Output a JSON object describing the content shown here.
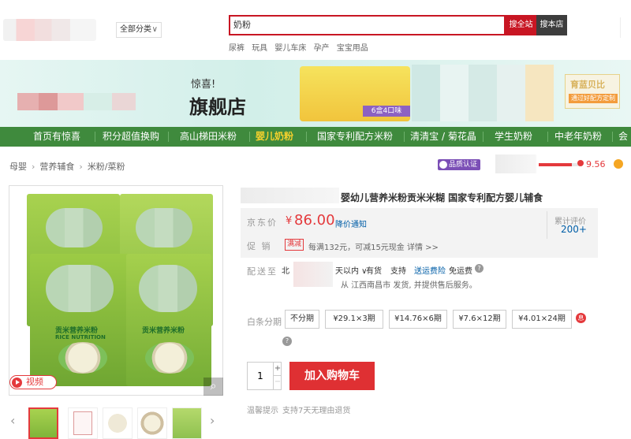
{
  "header": {
    "category_select": "全部分类",
    "search_value": "奶粉",
    "search_all_label": "搜全站",
    "search_store_label": "搜本店",
    "hot_words": [
      "尿裤",
      "玩具",
      "婴儿车床",
      "孕产",
      "宝宝用品"
    ]
  },
  "banner": {
    "headline_fragment": "惊喜!",
    "store_name_fragment": "旗舰店",
    "badge": "6盒4口味",
    "promo_title": "育蓝贝比",
    "promo_sub": "通过好配方定制"
  },
  "nav": {
    "items": [
      {
        "label": "首页有惊喜",
        "active": false
      },
      {
        "label": "积分超值换购",
        "active": false
      },
      {
        "label": "高山梯田米粉",
        "active": false
      },
      {
        "label": "婴儿奶粉",
        "active": true
      },
      {
        "label": "国家专利配方米粉",
        "active": false
      },
      {
        "label": "清清宝 / 菊花晶",
        "active": false
      },
      {
        "label": "学生奶粉",
        "active": false
      },
      {
        "label": "中老年奶粉",
        "active": false
      },
      {
        "label": "会",
        "active": false
      }
    ]
  },
  "breadcrumb": {
    "items": [
      "母婴",
      "营养辅食",
      "米粉/菜粉"
    ],
    "quality_badge": "品质认证",
    "score": "9.56",
    "score_fraction": 0.8
  },
  "product": {
    "package_title": "贡米营养米粉",
    "package_sub": "RICE NUTRITION",
    "video_label": "视频",
    "zoom_icon": "magnifier-icon",
    "name": "婴幼儿营养米粉贡米米糊 国家专利配方婴儿辅食",
    "price_label": "京东价",
    "price_symbol": "¥",
    "price": "86.00",
    "price_notice": "降价通知",
    "reviews_label": "累计评价",
    "reviews_count": "200+",
    "promo_label": "促 销",
    "promo_tag": "满减",
    "promo_text": "每满132元，可减15元现金  详情 >>",
    "ship_label": "配送至",
    "ship_dest": "北",
    "ship_within": "天以内 ∨",
    "ship_stock": "有货",
    "ship_support": "支持",
    "ship_insurance": "送运费险",
    "ship_free": "免运费",
    "ship_from": "从 江西南昌市 发货, 并提供售后服务。",
    "installment_label": "白条分期",
    "installment_options": [
      "不分期",
      "¥29.1×3期",
      "¥14.76×6期",
      "¥7.6×12期",
      "¥4.01×24期"
    ],
    "quantity": "1",
    "qty_plus": "+",
    "qty_minus": "−",
    "add_to_cart": "加入购物车",
    "tip_label": "温馨提示",
    "tip_text": "支持7天无理由退货"
  },
  "colors": {
    "brand_red": "#c81623",
    "nav_green": "#3f8a3d",
    "nav_active": "#f6d12d",
    "price_red": "#e4393c"
  }
}
